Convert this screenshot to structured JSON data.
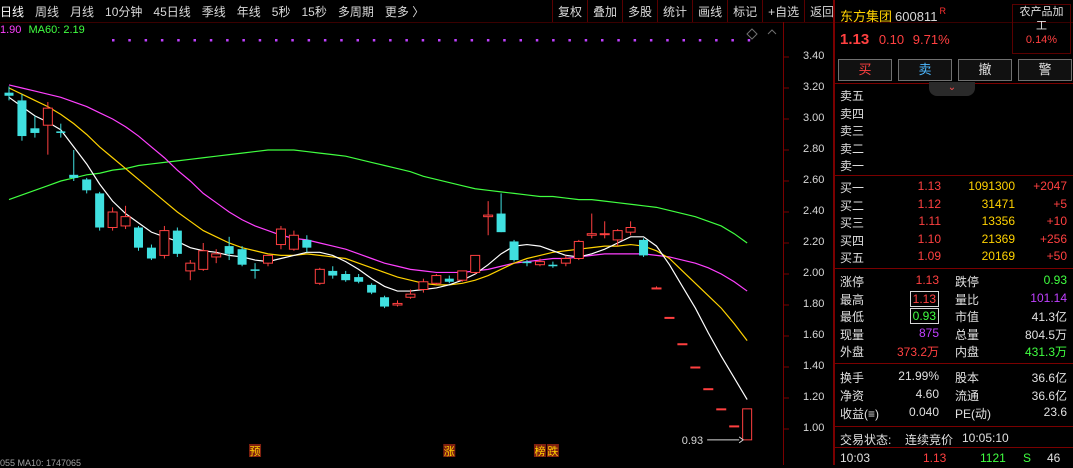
{
  "toolbar": {
    "periods": [
      "日线",
      "周线",
      "月线",
      "10分钟",
      "45日线",
      "季线",
      "年线",
      "5秒",
      "15秒",
      "多周期",
      "更多 〉"
    ],
    "tools": [
      "复权",
      "叠加",
      "多股",
      "统计",
      "画线",
      "标记",
      "+自选",
      "返回"
    ]
  },
  "ma_legend": {
    "prefix": "1.90",
    "ma60": "MA60: 2.19"
  },
  "bottom_strip": "055 MA10: 1747065",
  "colors": {
    "up": "#ff4040",
    "down": "#40e0e0",
    "ma5": "#ffffff",
    "ma10": "#ffd200",
    "ma20": "#ff40ff",
    "ma60": "#40ff40"
  },
  "chart_data": {
    "type": "candlestick",
    "y_ticks": [
      "3.40",
      "3.20",
      "3.00",
      "2.80",
      "2.60",
      "2.40",
      "2.20",
      "2.00",
      "1.80",
      "1.60",
      "1.40",
      "1.20",
      "1.00"
    ],
    "ylim": [
      0.9,
      3.47
    ],
    "low_label": "0.93",
    "markers": [
      {
        "text": "预",
        "bar": 19
      },
      {
        "text": "涨",
        "bar": 34
      },
      {
        "text": "榜",
        "bar": 41
      },
      {
        "text": "跌",
        "bar": 42
      }
    ],
    "candles": [
      {
        "o": 3.17,
        "h": 3.21,
        "l": 3.12,
        "c": 3.15
      },
      {
        "o": 3.12,
        "h": 3.16,
        "l": 2.86,
        "c": 2.89
      },
      {
        "o": 2.94,
        "h": 3.02,
        "l": 2.88,
        "c": 2.91
      },
      {
        "o": 2.96,
        "h": 3.11,
        "l": 2.77,
        "c": 3.07
      },
      {
        "o": 2.92,
        "h": 2.97,
        "l": 2.88,
        "c": 2.91
      },
      {
        "o": 2.64,
        "h": 2.8,
        "l": 2.6,
        "c": 2.62
      },
      {
        "o": 2.61,
        "h": 2.62,
        "l": 2.52,
        "c": 2.54
      },
      {
        "o": 2.52,
        "h": 2.53,
        "l": 2.28,
        "c": 2.3
      },
      {
        "o": 2.3,
        "h": 2.43,
        "l": 2.28,
        "c": 2.4
      },
      {
        "o": 2.31,
        "h": 2.44,
        "l": 2.29,
        "c": 2.37
      },
      {
        "o": 2.3,
        "h": 2.31,
        "l": 2.15,
        "c": 2.17
      },
      {
        "o": 2.17,
        "h": 2.19,
        "l": 2.09,
        "c": 2.1
      },
      {
        "o": 2.12,
        "h": 2.31,
        "l": 2.1,
        "c": 2.28
      },
      {
        "o": 2.28,
        "h": 2.3,
        "l": 2.11,
        "c": 2.13
      },
      {
        "o": 2.02,
        "h": 2.09,
        "l": 1.96,
        "c": 2.07
      },
      {
        "o": 2.03,
        "h": 2.2,
        "l": 2.02,
        "c": 2.15
      },
      {
        "o": 2.11,
        "h": 2.16,
        "l": 2.07,
        "c": 2.13
      },
      {
        "o": 2.18,
        "h": 2.24,
        "l": 2.09,
        "c": 2.13
      },
      {
        "o": 2.16,
        "h": 2.18,
        "l": 2.05,
        "c": 2.06
      },
      {
        "o": 2.03,
        "h": 2.07,
        "l": 1.97,
        "c": 2.02
      },
      {
        "o": 2.07,
        "h": 2.12,
        "l": 2.05,
        "c": 2.12
      },
      {
        "o": 2.19,
        "h": 2.31,
        "l": 2.16,
        "c": 2.29
      },
      {
        "o": 2.16,
        "h": 2.28,
        "l": 2.15,
        "c": 2.25
      },
      {
        "o": 2.22,
        "h": 2.25,
        "l": 2.14,
        "c": 2.17
      },
      {
        "o": 1.94,
        "h": 2.04,
        "l": 1.93,
        "c": 2.03
      },
      {
        "o": 2.02,
        "h": 2.05,
        "l": 1.97,
        "c": 1.99
      },
      {
        "o": 2.0,
        "h": 2.02,
        "l": 1.95,
        "c": 1.96
      },
      {
        "o": 1.98,
        "h": 2.0,
        "l": 1.94,
        "c": 1.95
      },
      {
        "o": 1.93,
        "h": 1.94,
        "l": 1.87,
        "c": 1.88
      },
      {
        "o": 1.85,
        "h": 1.86,
        "l": 1.78,
        "c": 1.79
      },
      {
        "o": 1.8,
        "h": 1.83,
        "l": 1.79,
        "c": 1.81
      },
      {
        "o": 1.85,
        "h": 1.9,
        "l": 1.84,
        "c": 1.87
      },
      {
        "o": 1.9,
        "h": 1.97,
        "l": 1.88,
        "c": 1.95
      },
      {
        "o": 1.94,
        "h": 2.0,
        "l": 1.93,
        "c": 1.99
      },
      {
        "o": 1.97,
        "h": 1.99,
        "l": 1.94,
        "c": 1.95
      },
      {
        "o": 1.96,
        "h": 2.02,
        "l": 1.95,
        "c": 2.02
      },
      {
        "o": 2.01,
        "h": 2.12,
        "l": 2.0,
        "c": 2.12
      },
      {
        "o": 2.37,
        "h": 2.47,
        "l": 2.25,
        "c": 2.38
      },
      {
        "o": 2.39,
        "h": 2.52,
        "l": 2.27,
        "c": 2.27
      },
      {
        "o": 2.21,
        "h": 2.22,
        "l": 2.08,
        "c": 2.09
      },
      {
        "o": 2.08,
        "h": 2.09,
        "l": 2.05,
        "c": 2.07
      },
      {
        "o": 2.06,
        "h": 2.1,
        "l": 2.05,
        "c": 2.08
      },
      {
        "o": 2.06,
        "h": 2.08,
        "l": 2.04,
        "c": 2.05
      },
      {
        "o": 2.07,
        "h": 2.12,
        "l": 2.05,
        "c": 2.1
      },
      {
        "o": 2.1,
        "h": 2.22,
        "l": 2.09,
        "c": 2.21
      },
      {
        "o": 2.25,
        "h": 2.39,
        "l": 2.23,
        "c": 2.26
      },
      {
        "o": 2.26,
        "h": 2.34,
        "l": 2.23,
        "c": 2.26
      },
      {
        "o": 2.22,
        "h": 2.29,
        "l": 2.18,
        "c": 2.28
      },
      {
        "o": 2.27,
        "h": 2.34,
        "l": 2.25,
        "c": 2.3
      },
      {
        "o": 2.22,
        "h": 2.23,
        "l": 2.11,
        "c": 2.12
      },
      {
        "o": 1.91,
        "h": 1.92,
        "l": 1.91,
        "c": 1.91
      },
      {
        "o": 1.72,
        "h": 1.72,
        "l": 1.72,
        "c": 1.72
      },
      {
        "o": 1.55,
        "h": 1.55,
        "l": 1.55,
        "c": 1.55
      },
      {
        "o": 1.4,
        "h": 1.4,
        "l": 1.4,
        "c": 1.4
      },
      {
        "o": 1.26,
        "h": 1.26,
        "l": 1.26,
        "c": 1.26
      },
      {
        "o": 1.13,
        "h": 1.13,
        "l": 1.13,
        "c": 1.13
      },
      {
        "o": 1.02,
        "h": 1.02,
        "l": 1.02,
        "c": 1.02
      },
      {
        "o": 0.93,
        "h": 1.13,
        "l": 0.93,
        "c": 1.13
      }
    ],
    "ma5": [
      3.14,
      3.08,
      3.02,
      2.98,
      2.93,
      2.82,
      2.71,
      2.58,
      2.47,
      2.39,
      2.33,
      2.27,
      2.24,
      2.21,
      2.17,
      2.15,
      2.14,
      2.12,
      2.11,
      2.09,
      2.08,
      2.1,
      2.12,
      2.14,
      2.14,
      2.12,
      2.08,
      2.03,
      1.97,
      1.92,
      1.89,
      1.89,
      1.9,
      1.91,
      1.93,
      1.96,
      2.0,
      2.06,
      2.13,
      2.18,
      2.19,
      2.18,
      2.15,
      2.12,
      2.11,
      2.13,
      2.16,
      2.2,
      2.24,
      2.24,
      2.18,
      2.06,
      1.92,
      1.78,
      1.62,
      1.47,
      1.33,
      1.19
    ],
    "ma10": [
      3.2,
      3.16,
      3.12,
      3.08,
      3.03,
      2.97,
      2.9,
      2.82,
      2.75,
      2.68,
      2.61,
      2.54,
      2.47,
      2.4,
      2.34,
      2.28,
      2.24,
      2.2,
      2.17,
      2.15,
      2.13,
      2.12,
      2.12,
      2.13,
      2.12,
      2.11,
      2.1,
      2.07,
      2.04,
      2.01,
      1.98,
      1.96,
      1.94,
      1.93,
      1.93,
      1.94,
      1.96,
      1.99,
      2.03,
      2.07,
      2.1,
      2.12,
      2.14,
      2.15,
      2.16,
      2.17,
      2.18,
      2.18,
      2.19,
      2.18,
      2.15,
      2.1,
      2.02,
      1.94,
      1.86,
      1.78,
      1.68,
      1.57
    ],
    "ma20": [
      3.22,
      3.2,
      3.18,
      3.16,
      3.14,
      3.11,
      3.08,
      3.04,
      3.0,
      2.95,
      2.89,
      2.82,
      2.75,
      2.67,
      2.6,
      2.52,
      2.46,
      2.4,
      2.35,
      2.31,
      2.28,
      2.25,
      2.23,
      2.22,
      2.2,
      2.18,
      2.16,
      2.13,
      2.1,
      2.07,
      2.05,
      2.03,
      2.02,
      2.01,
      2.01,
      2.01,
      2.02,
      2.03,
      2.05,
      2.07,
      2.08,
      2.09,
      2.1,
      2.1,
      2.11,
      2.12,
      2.13,
      2.13,
      2.13,
      2.13,
      2.12,
      2.11,
      2.09,
      2.07,
      2.04,
      2.0,
      1.95,
      1.89
    ],
    "ma60": [
      2.48,
      2.51,
      2.54,
      2.57,
      2.6,
      2.62,
      2.64,
      2.65,
      2.67,
      2.68,
      2.7,
      2.71,
      2.72,
      2.73,
      2.74,
      2.75,
      2.76,
      2.77,
      2.78,
      2.79,
      2.8,
      2.8,
      2.8,
      2.79,
      2.78,
      2.77,
      2.76,
      2.74,
      2.72,
      2.7,
      2.68,
      2.66,
      2.63,
      2.61,
      2.59,
      2.57,
      2.55,
      2.54,
      2.53,
      2.52,
      2.51,
      2.5,
      2.5,
      2.49,
      2.48,
      2.48,
      2.47,
      2.46,
      2.45,
      2.44,
      2.43,
      2.41,
      2.39,
      2.37,
      2.34,
      2.31,
      2.26,
      2.2
    ]
  },
  "quote": {
    "name": "东方集团",
    "code": "600811",
    "r_badge": "R",
    "sector_name_1": "农产品加",
    "sector_name_2": "工",
    "sector_pct": "0.14%",
    "price": "1.13",
    "change": "0.10",
    "pct": "9.71%",
    "buttons": {
      "buy": "买",
      "sell": "卖",
      "cancel": "撤",
      "alert": "警"
    },
    "collapse_icon": "⌄",
    "sell_levels": [
      "卖五",
      "卖四",
      "卖三",
      "卖二",
      "卖一"
    ],
    "buy_levels": [
      {
        "label": "买一",
        "price": "1.13",
        "vol": "1091300",
        "chg": "+2047"
      },
      {
        "label": "买二",
        "price": "1.12",
        "vol": "31471",
        "chg": "+5"
      },
      {
        "label": "买三",
        "price": "1.11",
        "vol": "13356",
        "chg": "+10"
      },
      {
        "label": "买四",
        "price": "1.10",
        "vol": "21369",
        "chg": "+256"
      },
      {
        "label": "买五",
        "price": "1.09",
        "vol": "20169",
        "chg": "+50"
      }
    ],
    "stats": {
      "limit_up_l": "涨停",
      "limit_up": "1.13",
      "limit_down_l": "跌停",
      "limit_down": "0.93",
      "high_l": "最高",
      "high": "1.13",
      "vol_ratio_l": "量比",
      "vol_ratio": "101.14",
      "low_l": "最低",
      "low": "0.93",
      "mcap_l": "市值",
      "mcap": "41.3亿",
      "cur_l": "现量",
      "cur": "875",
      "total_l": "总量",
      "total": "804.5万",
      "outer_l": "外盘",
      "outer": "373.2万",
      "inner_l": "内盘",
      "inner": "431.3万",
      "turn_l": "换手",
      "turn": "21.99%",
      "shares_l": "股本",
      "shares": "36.6亿",
      "nav_l": "净资",
      "nav": "4.60",
      "float_l": "流通",
      "float": "36.6亿",
      "eps_l": "收益(≡)",
      "eps": "0.040",
      "pe_l": "PE(动)",
      "pe": "23.6"
    },
    "status_label": "交易状态:",
    "status": "连续竞价",
    "status_time": "10:05:10",
    "tick": {
      "time": "10:03",
      "price": "1.13",
      "vol": "1121",
      "side": "S",
      "n": "46"
    }
  }
}
